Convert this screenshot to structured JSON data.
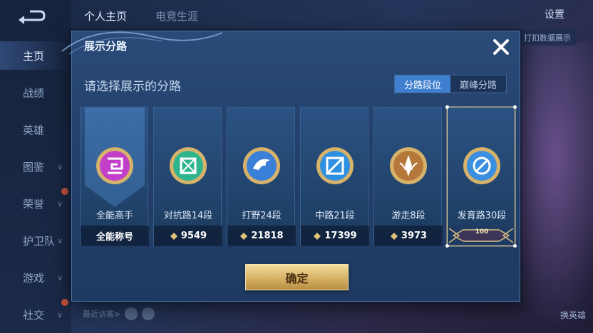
{
  "background": {
    "top_tabs": [
      {
        "label": "个人主页",
        "active": true
      },
      {
        "label": "电竞生涯",
        "active": false
      }
    ],
    "settings_label": "设置",
    "right_button_label": "打扣数据展示",
    "sidebar": [
      {
        "label": "主页",
        "active": true,
        "chevron": false
      },
      {
        "label": "战绩",
        "active": false,
        "chevron": false
      },
      {
        "label": "英雄",
        "active": false,
        "chevron": false
      },
      {
        "label": "图鉴",
        "active": false,
        "chevron": true
      },
      {
        "label": "荣誉",
        "active": false,
        "chevron": true
      },
      {
        "label": "护卫队",
        "active": false,
        "chevron": true
      },
      {
        "label": "游戏",
        "active": false,
        "chevron": true
      },
      {
        "label": "社交",
        "active": false,
        "chevron": true
      }
    ],
    "recent_visitors_label": "最近访客>",
    "change_hero_label": "换英雄"
  },
  "dialog": {
    "title": "展示分路",
    "subtitle": "请选择展示的分路",
    "tabs": [
      {
        "label": "分路段位",
        "active": true
      },
      {
        "label": "巅峰分路",
        "active": false
      }
    ],
    "cards": [
      {
        "name": "全能高手",
        "footer": "全能称号",
        "points": null,
        "selected": false,
        "highlight": true,
        "emblem_color": "#c23fc9",
        "emblem_icon": "allround-icon"
      },
      {
        "name": "对抗路14段",
        "footer": null,
        "points": "9549",
        "selected": false,
        "highlight": false,
        "emblem_color": "#2fb58e",
        "emblem_icon": "clash-lane-icon"
      },
      {
        "name": "打野24段",
        "footer": null,
        "points": "21818",
        "selected": false,
        "highlight": false,
        "emblem_color": "#3a7fd8",
        "emblem_icon": "jungle-icon"
      },
      {
        "name": "中路21段",
        "footer": null,
        "points": "17399",
        "selected": false,
        "highlight": false,
        "emblem_color": "#2f8fe0",
        "emblem_icon": "mid-lane-icon"
      },
      {
        "name": "游走8段",
        "footer": null,
        "points": "3973",
        "selected": false,
        "highlight": false,
        "emblem_color": "#b5783a",
        "emblem_icon": "roam-icon"
      },
      {
        "name": "发育路30段",
        "footer": null,
        "points": null,
        "rank": "100",
        "selected": true,
        "highlight": false,
        "emblem_color": "#3a8fe0",
        "emblem_icon": "farm-lane-icon"
      }
    ],
    "confirm_label": "确定"
  }
}
